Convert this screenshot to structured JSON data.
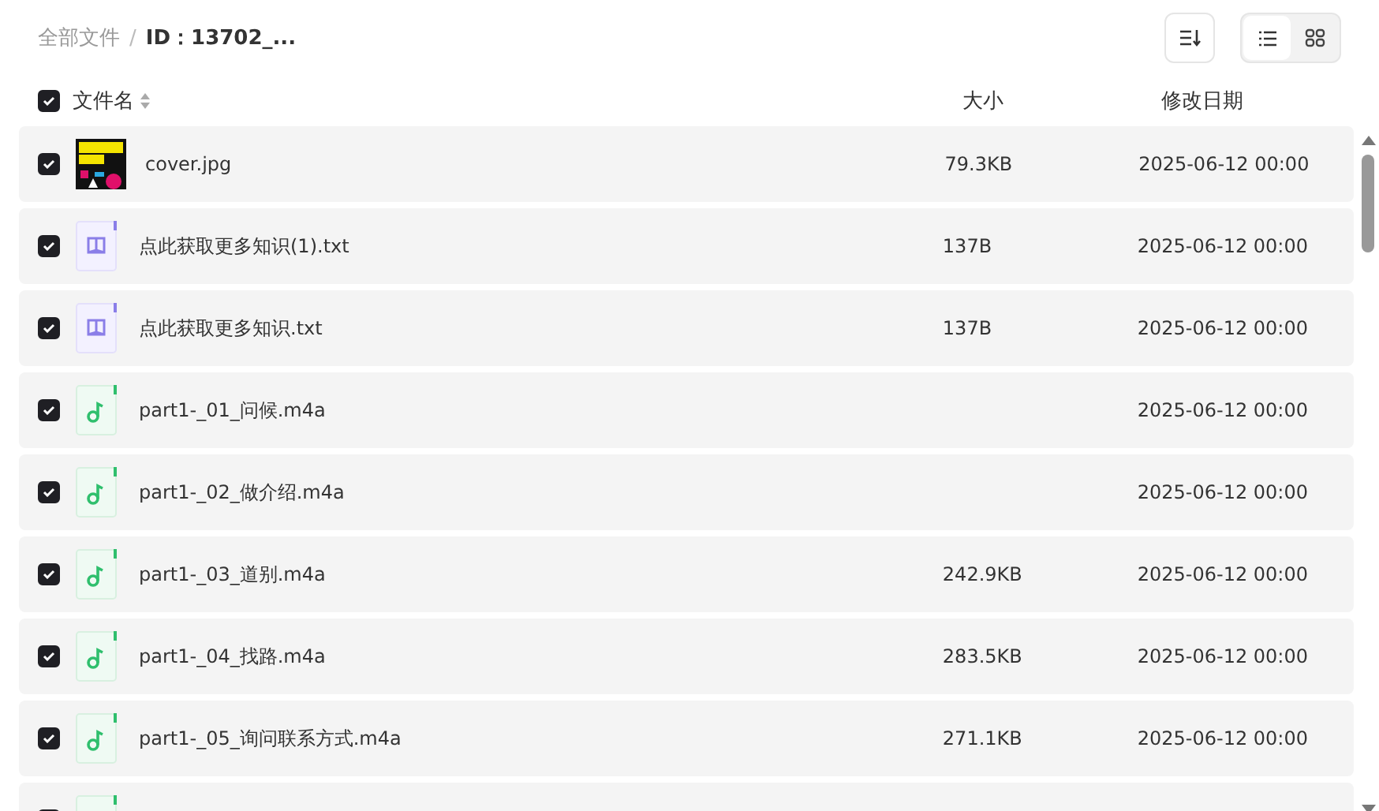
{
  "breadcrumb": {
    "root": "全部文件",
    "separator": "/",
    "current": "ID：13702_..."
  },
  "toolbar": {
    "view_modes": [
      {
        "kind": "list",
        "selected": true
      },
      {
        "kind": "grid",
        "selected": false
      }
    ]
  },
  "header": {
    "checked": true,
    "name": "文件名",
    "size": "大小",
    "date": "修改日期"
  },
  "files": [
    {
      "kind": "image",
      "checked": true,
      "name": "cover.jpg",
      "size": "79.3KB",
      "date": "2025-06-12 00:00"
    },
    {
      "kind": "doc",
      "checked": true,
      "name": "点此获取更多知识(1).txt",
      "size": "137B",
      "date": "2025-06-12 00:00"
    },
    {
      "kind": "doc",
      "checked": true,
      "name": "点此获取更多知识.txt",
      "size": "137B",
      "date": "2025-06-12 00:00"
    },
    {
      "kind": "audio",
      "checked": true,
      "name": "part1-_01_问候.m4a",
      "date": "2025-06-12 00:00"
    },
    {
      "kind": "audio",
      "checked": true,
      "name": "part1-_02_做介绍.m4a",
      "date": "2025-06-12 00:00"
    },
    {
      "kind": "audio",
      "checked": true,
      "name": "part1-_03_道别.m4a",
      "size": "242.9KB",
      "date": "2025-06-12 00:00"
    },
    {
      "kind": "audio",
      "checked": true,
      "name": "part1-_04_找路.m4a",
      "size": "283.5KB",
      "date": "2025-06-12 00:00"
    },
    {
      "kind": "audio",
      "checked": true,
      "name": "part1-_05_询问联系方式.m4a",
      "size": "271.1KB",
      "date": "2025-06-12 00:00"
    },
    {
      "kind": "audio",
      "checked": true
    }
  ]
}
